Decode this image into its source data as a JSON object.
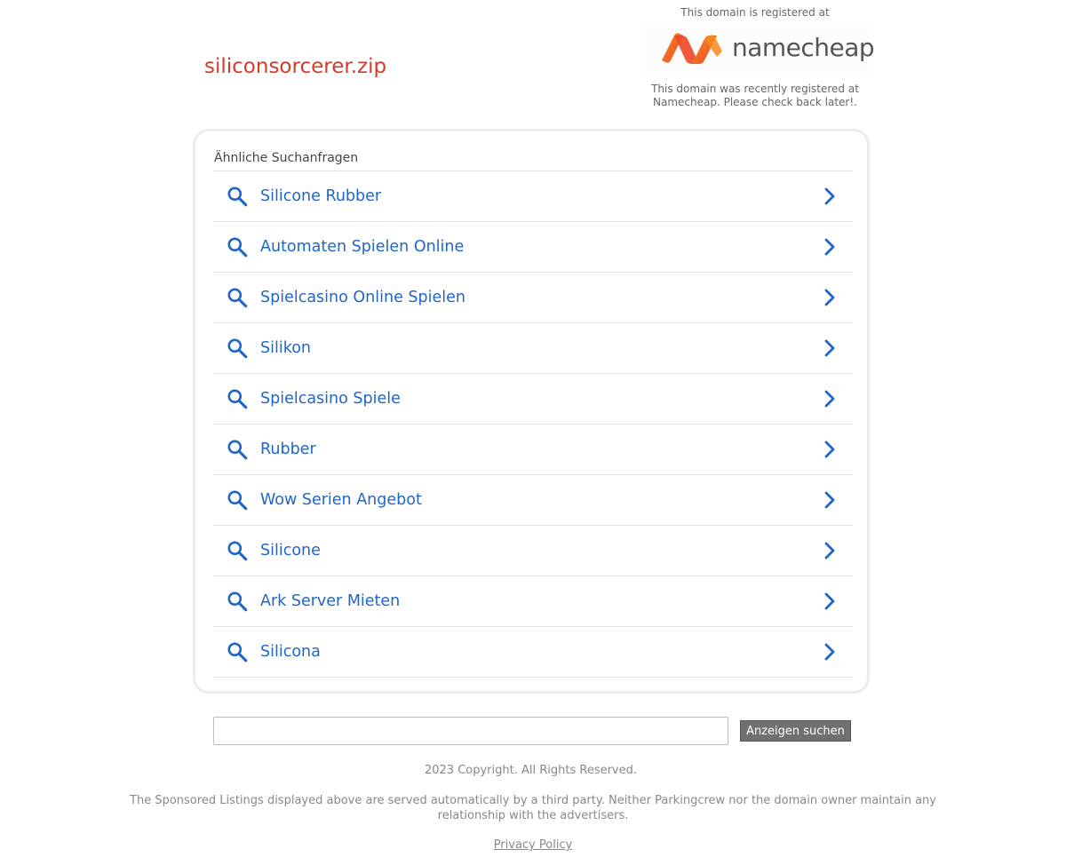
{
  "domain": {
    "name": "siliconsorcerer.zip"
  },
  "registrar": {
    "registered_at_text": "This domain is registered at",
    "logo_text": "namecheap",
    "logo_icon": "namecheap-logo-icon",
    "note_line1": "This domain was recently registered at",
    "note_line2": "Namecheap. Please check back later!."
  },
  "related": {
    "heading": "Ähnliche Suchanfragen",
    "items": [
      {
        "label": "Silicone Rubber"
      },
      {
        "label": "Automaten Spielen Online"
      },
      {
        "label": "Spielcasino Online Spielen"
      },
      {
        "label": "Silikon"
      },
      {
        "label": "Spielcasino Spiele"
      },
      {
        "label": "Rubber"
      },
      {
        "label": "Wow Serien Angebot"
      },
      {
        "label": "Silicone"
      },
      {
        "label": "Ark Server Mieten"
      },
      {
        "label": "Silicona"
      }
    ],
    "item_icon": "search-icon",
    "item_arrow": "chevron-right-icon"
  },
  "search": {
    "value": "",
    "placeholder": "",
    "button_label": "Anzeigen suchen"
  },
  "footer": {
    "copyright": "2023 Copyright. All Rights Reserved.",
    "disclaimer": "The Sponsored Listings displayed above are served automatically by a third party. Neither Parkingcrew nor the domain owner maintain any relationship with the advertisers.",
    "privacy_label": "Privacy Policy"
  },
  "colors": {
    "domain_title": "#d43b2a",
    "link_blue": "#1f66c9",
    "namecheap_orange": "#f26a2a",
    "button_bg": "#707070"
  }
}
